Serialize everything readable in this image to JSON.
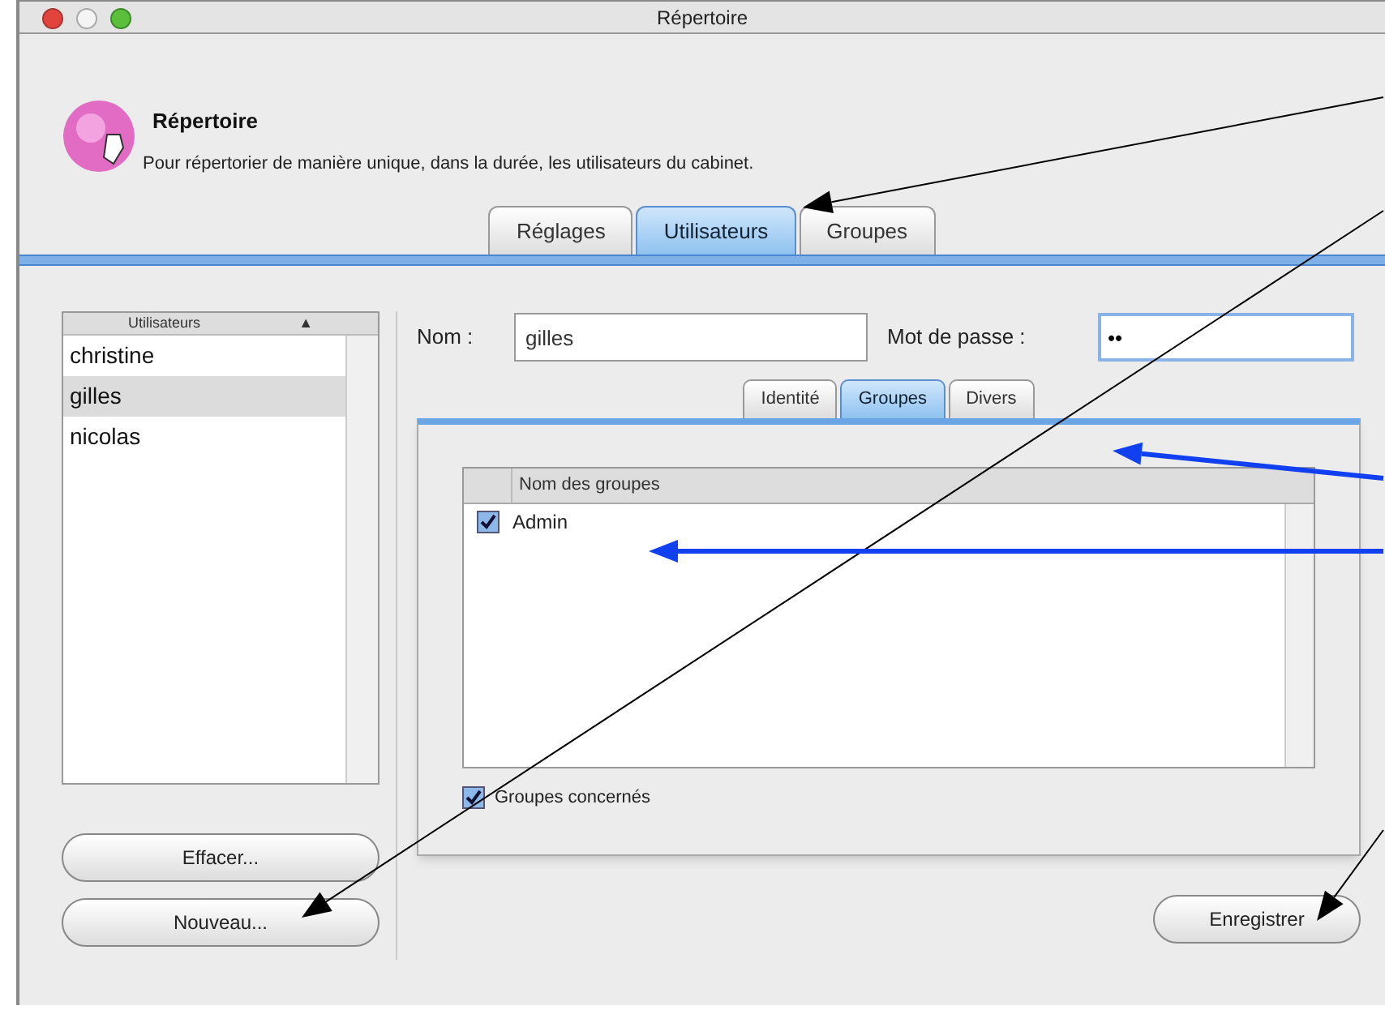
{
  "window": {
    "title": "Répertoire"
  },
  "header": {
    "title": "Répertoire",
    "description": "Pour répertorier de manière unique, dans la durée, les utilisateurs du cabinet."
  },
  "tabs": [
    {
      "label": "Réglages",
      "selected": false
    },
    {
      "label": "Utilisateurs",
      "selected": true
    },
    {
      "label": "Groupes",
      "selected": false
    }
  ],
  "users_list": {
    "column": "Utilisateurs",
    "sort_indicator": "▲",
    "rows": [
      {
        "name": "christine",
        "selected": false
      },
      {
        "name": "gilles",
        "selected": true
      },
      {
        "name": "nicolas",
        "selected": false
      }
    ]
  },
  "list_buttons": [
    "Effacer...",
    "Nouveau..."
  ],
  "form": {
    "name_label": "Nom :",
    "name_value": "gilles",
    "password_label": "Mot de passe :",
    "password_value": "••"
  },
  "inner_tabs": [
    {
      "label": "Identité",
      "selected": false
    },
    {
      "label": "Groupes",
      "selected": true
    },
    {
      "label": "Divers",
      "selected": false
    }
  ],
  "groups_table": {
    "column": "Nom des groupes",
    "rows": [
      {
        "name": "Admin",
        "checked": true
      }
    ]
  },
  "groups_checkbox": {
    "label": "Groupes concernés",
    "checked": true
  },
  "save_button": "Enregistrer"
}
